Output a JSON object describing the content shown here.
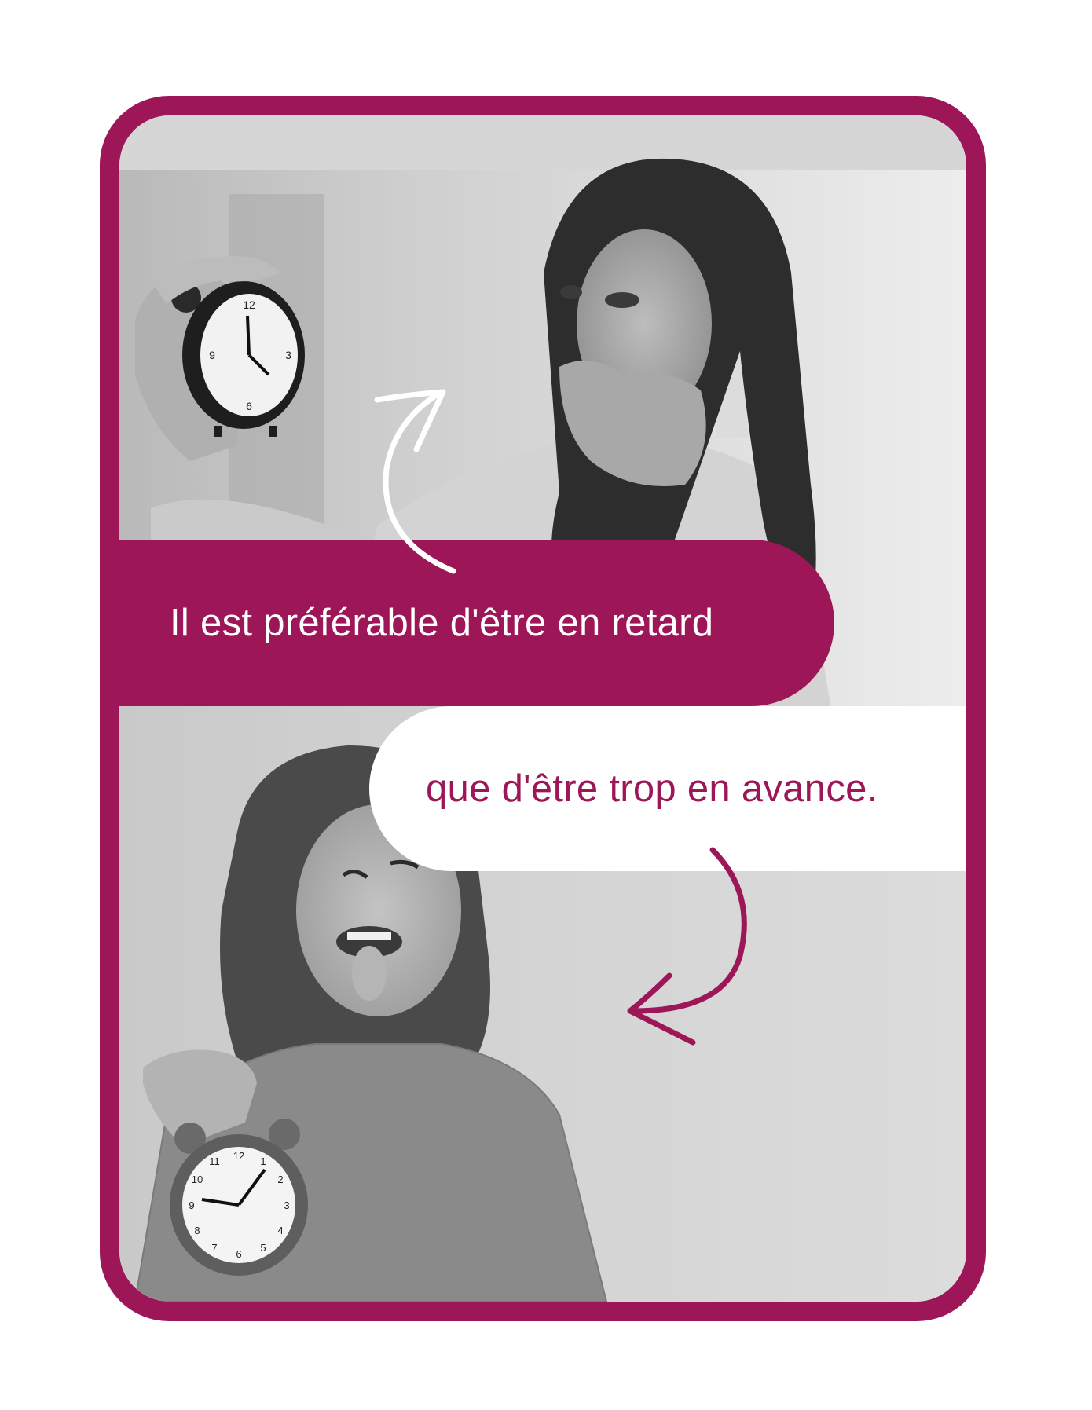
{
  "card": {
    "accent_color": "#9d1657",
    "top_caption": "Il est préférable d'être en retard",
    "bottom_caption": "que d'être trop en avance."
  },
  "photos": {
    "top": {
      "subject": "woman looking surprised at alarm clock",
      "clock_numbers": [
        "12",
        "3",
        "6",
        "9"
      ]
    },
    "bottom": {
      "subject": "woman sticking out tongue holding alarm clock",
      "clock_numbers": [
        "12",
        "1",
        "2",
        "3",
        "4",
        "5",
        "6",
        "7",
        "8",
        "9",
        "10",
        "11"
      ]
    }
  },
  "icons": {
    "top_arrow": "curved-arrow-up-icon",
    "bottom_arrow": "curved-arrow-down-icon"
  }
}
